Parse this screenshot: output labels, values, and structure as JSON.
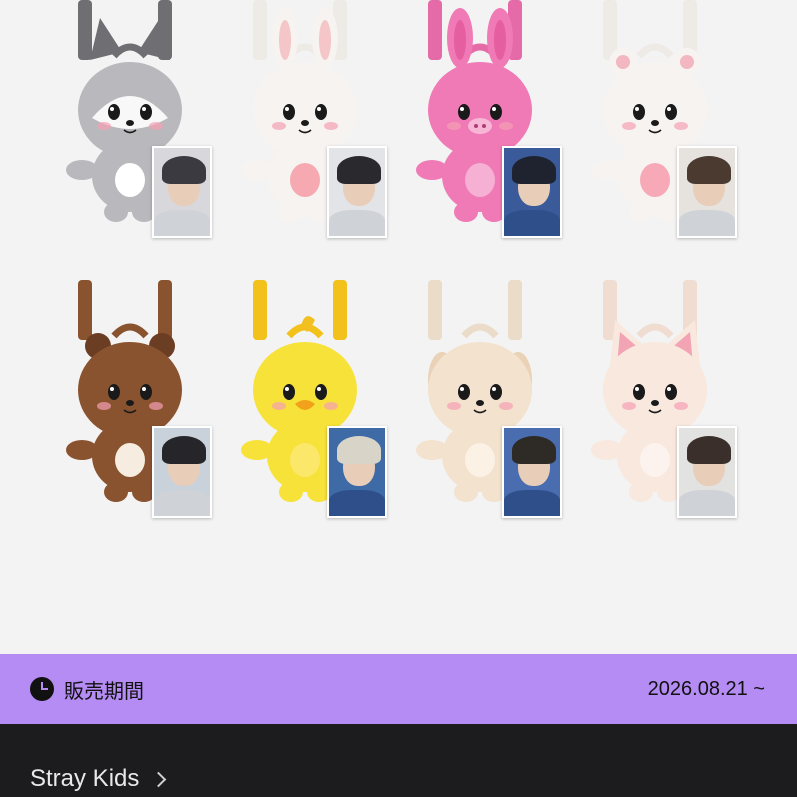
{
  "products": [
    {
      "character": "wolf",
      "body": "#b9b9bd",
      "accent": "#6e6e73",
      "belly": "#ffffff",
      "strap": "#6e6e73",
      "card_hair": "#3a3a40",
      "card_bg": "#d8d8dc"
    },
    {
      "character": "rabbit",
      "body": "#f6f3f0",
      "accent": "#f4c6c8",
      "belly": "#f7a9b1",
      "strap": "#eeeae6",
      "card_hair": "#2a2a2e",
      "card_bg": "#e3e4e8"
    },
    {
      "character": "pig-rabbit",
      "body": "#f07ab6",
      "accent": "#e55ea0",
      "belly": "#f5b0d4",
      "strap": "#e56aa8",
      "card_hair": "#1f2330",
      "card_bg": "#3b5a9a"
    },
    {
      "character": "cat",
      "body": "#f7f3f0",
      "accent": "#f2b7c0",
      "belly": "#f7a9b7",
      "strap": "#eeeae6",
      "card_hair": "#4a3a30",
      "card_bg": "#e6e3df"
    },
    {
      "character": "quokka",
      "body": "#8a5330",
      "accent": "#6b3d22",
      "belly": "#f7ece0",
      "strap": "#8a5330",
      "card_hair": "#25252a",
      "card_bg": "#c9d1da"
    },
    {
      "character": "chick",
      "body": "#f7e23a",
      "accent": "#f2c020",
      "belly": "#fbe86a",
      "strap": "#f2c21a",
      "card_hair": "#d8d4c8",
      "card_bg": "#3e6aa6"
    },
    {
      "character": "puppy",
      "body": "#f3e2cd",
      "accent": "#e9d2b6",
      "belly": "#fbf1e4",
      "strap": "#eadcc8",
      "card_hair": "#2e2a26",
      "card_bg": "#4a6db0"
    },
    {
      "character": "fox",
      "body": "#f8e8de",
      "accent": "#f2a3b4",
      "belly": "#fdf3ee",
      "strap": "#f0dcd0",
      "card_hair": "#3a2f2a",
      "card_bg": "#e2e2e0"
    }
  ],
  "sale": {
    "icon": "clock-icon",
    "label": "販売期間",
    "date": "2026.08.21 ~",
    "bar_color": "#b48cf3"
  },
  "artist": {
    "name": "Stray Kids",
    "icon": "chevron-right-icon"
  }
}
